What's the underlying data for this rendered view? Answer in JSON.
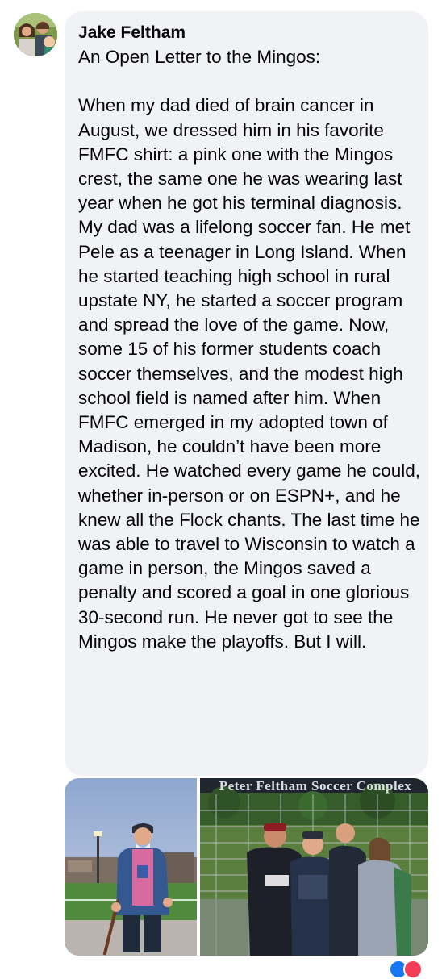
{
  "post": {
    "author": "Jake Feltham",
    "text": "An Open Letter to the Mingos:\n\nWhen my dad died of brain cancer in August, we dressed him in his favorite FMFC shirt: a pink one with the Mingos crest, the same one he was wearing last year when he got his terminal diagnosis. My dad was a lifelong soccer fan. He met Pele as a teenager in Long Island. When he started teaching high school in rural upstate NY, he started a soccer program and spread the love of the game. Now, some 15 of his former students coach soccer themselves, and the modest high school field is named after him. When FMFC emerged in my adopted town of Madison, he couldn’t have been more excited. He watched every game he could, whether in-person or on ESPN+, and he knew all the Flock chants. The last time he was able to travel to Wisconsin to watch a game in person, the Mingos saved a penalty and scored a goal in one glorious 30-second run. He never got to see the Mingos make the playoffs. But I will."
  },
  "photos": {
    "sign_text": "Peter Feltham Soccer Complex"
  },
  "reactions": [
    "like-icon",
    "love-icon"
  ],
  "colors": {
    "bubble": "#f0f2f5",
    "text": "#050505",
    "like": "#1877f2",
    "love": "#f33e58"
  }
}
